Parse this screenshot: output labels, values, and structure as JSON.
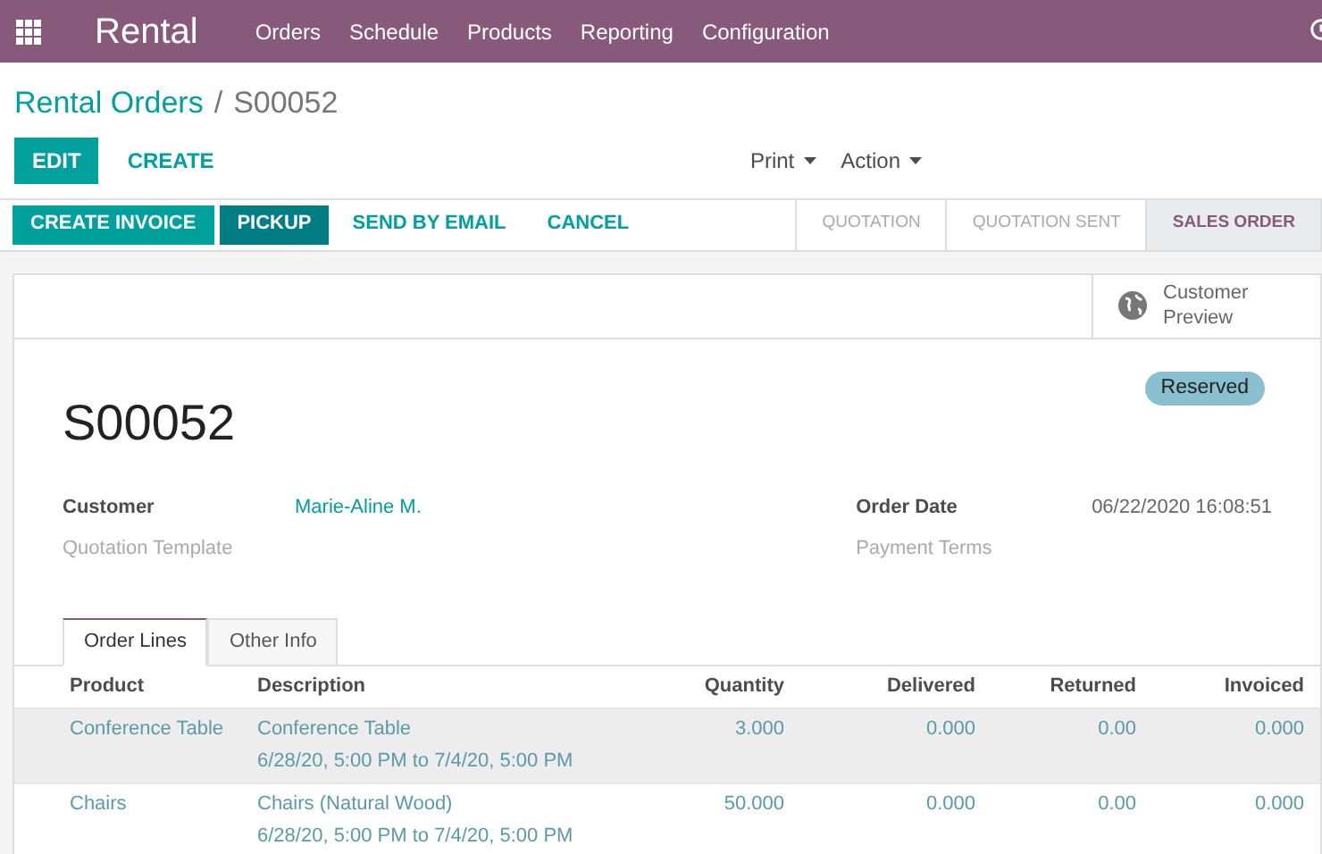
{
  "navbar": {
    "app": "Rental",
    "menu": [
      "Orders",
      "Schedule",
      "Products",
      "Reporting",
      "Configuration"
    ]
  },
  "breadcrumb": {
    "parent": "Rental Orders",
    "separator": "/",
    "current": "S00052"
  },
  "control_buttons": [
    {
      "label": "EDIT",
      "kind": "primary"
    },
    {
      "label": "CREATE",
      "kind": "link"
    }
  ],
  "dropdowns": [
    "Print",
    "Action"
  ],
  "action_buttons": [
    {
      "label": "CREATE INVOICE",
      "kind": "primary"
    },
    {
      "label": "PICKUP",
      "kind": "dark"
    },
    {
      "label": "SEND BY EMAIL",
      "kind": "link"
    },
    {
      "label": "CANCEL",
      "kind": "link"
    }
  ],
  "stages": [
    {
      "label": "QUOTATION",
      "selected": false
    },
    {
      "label": "QUOTATION SENT",
      "selected": false
    },
    {
      "label": "SALES ORDER",
      "selected": true
    }
  ],
  "smart_button": {
    "label": "Customer Preview"
  },
  "record": {
    "name": "S00052",
    "badge": "Reserved"
  },
  "fields_left": [
    {
      "label": "Customer",
      "value": "Marie-Aline M.",
      "required": true
    },
    {
      "label": "Quotation Template",
      "required": false
    }
  ],
  "fields_right": [
    {
      "label": "Order Date",
      "value": "06/22/2020 16:08:51",
      "required": true
    },
    {
      "label": "Payment Terms",
      "required": false
    }
  ],
  "tabs": [
    {
      "label": "Order Lines",
      "selected": true
    },
    {
      "label": "Other Info",
      "selected": false
    }
  ],
  "table": {
    "columns": [
      "Product",
      "Description",
      "Quantity",
      "Delivered",
      "Returned",
      "Invoiced"
    ],
    "rows": [
      {
        "product": "Conference Table",
        "description": "Conference Table",
        "period": "6/28/20, 5:00 PM to 7/4/20, 5:00 PM",
        "quantity": "3.000",
        "delivered": "0.000",
        "returned": "0.00",
        "invoiced": "0.000",
        "selected": true
      },
      {
        "product": "Chairs",
        "description": "Chairs (Natural Wood)",
        "period": "6/28/20, 5:00 PM to 7/4/20, 5:00 PM",
        "quantity": "50.000",
        "delivered": "0.000",
        "returned": "0.00",
        "invoiced": "0.000",
        "selected": false
      }
    ]
  }
}
